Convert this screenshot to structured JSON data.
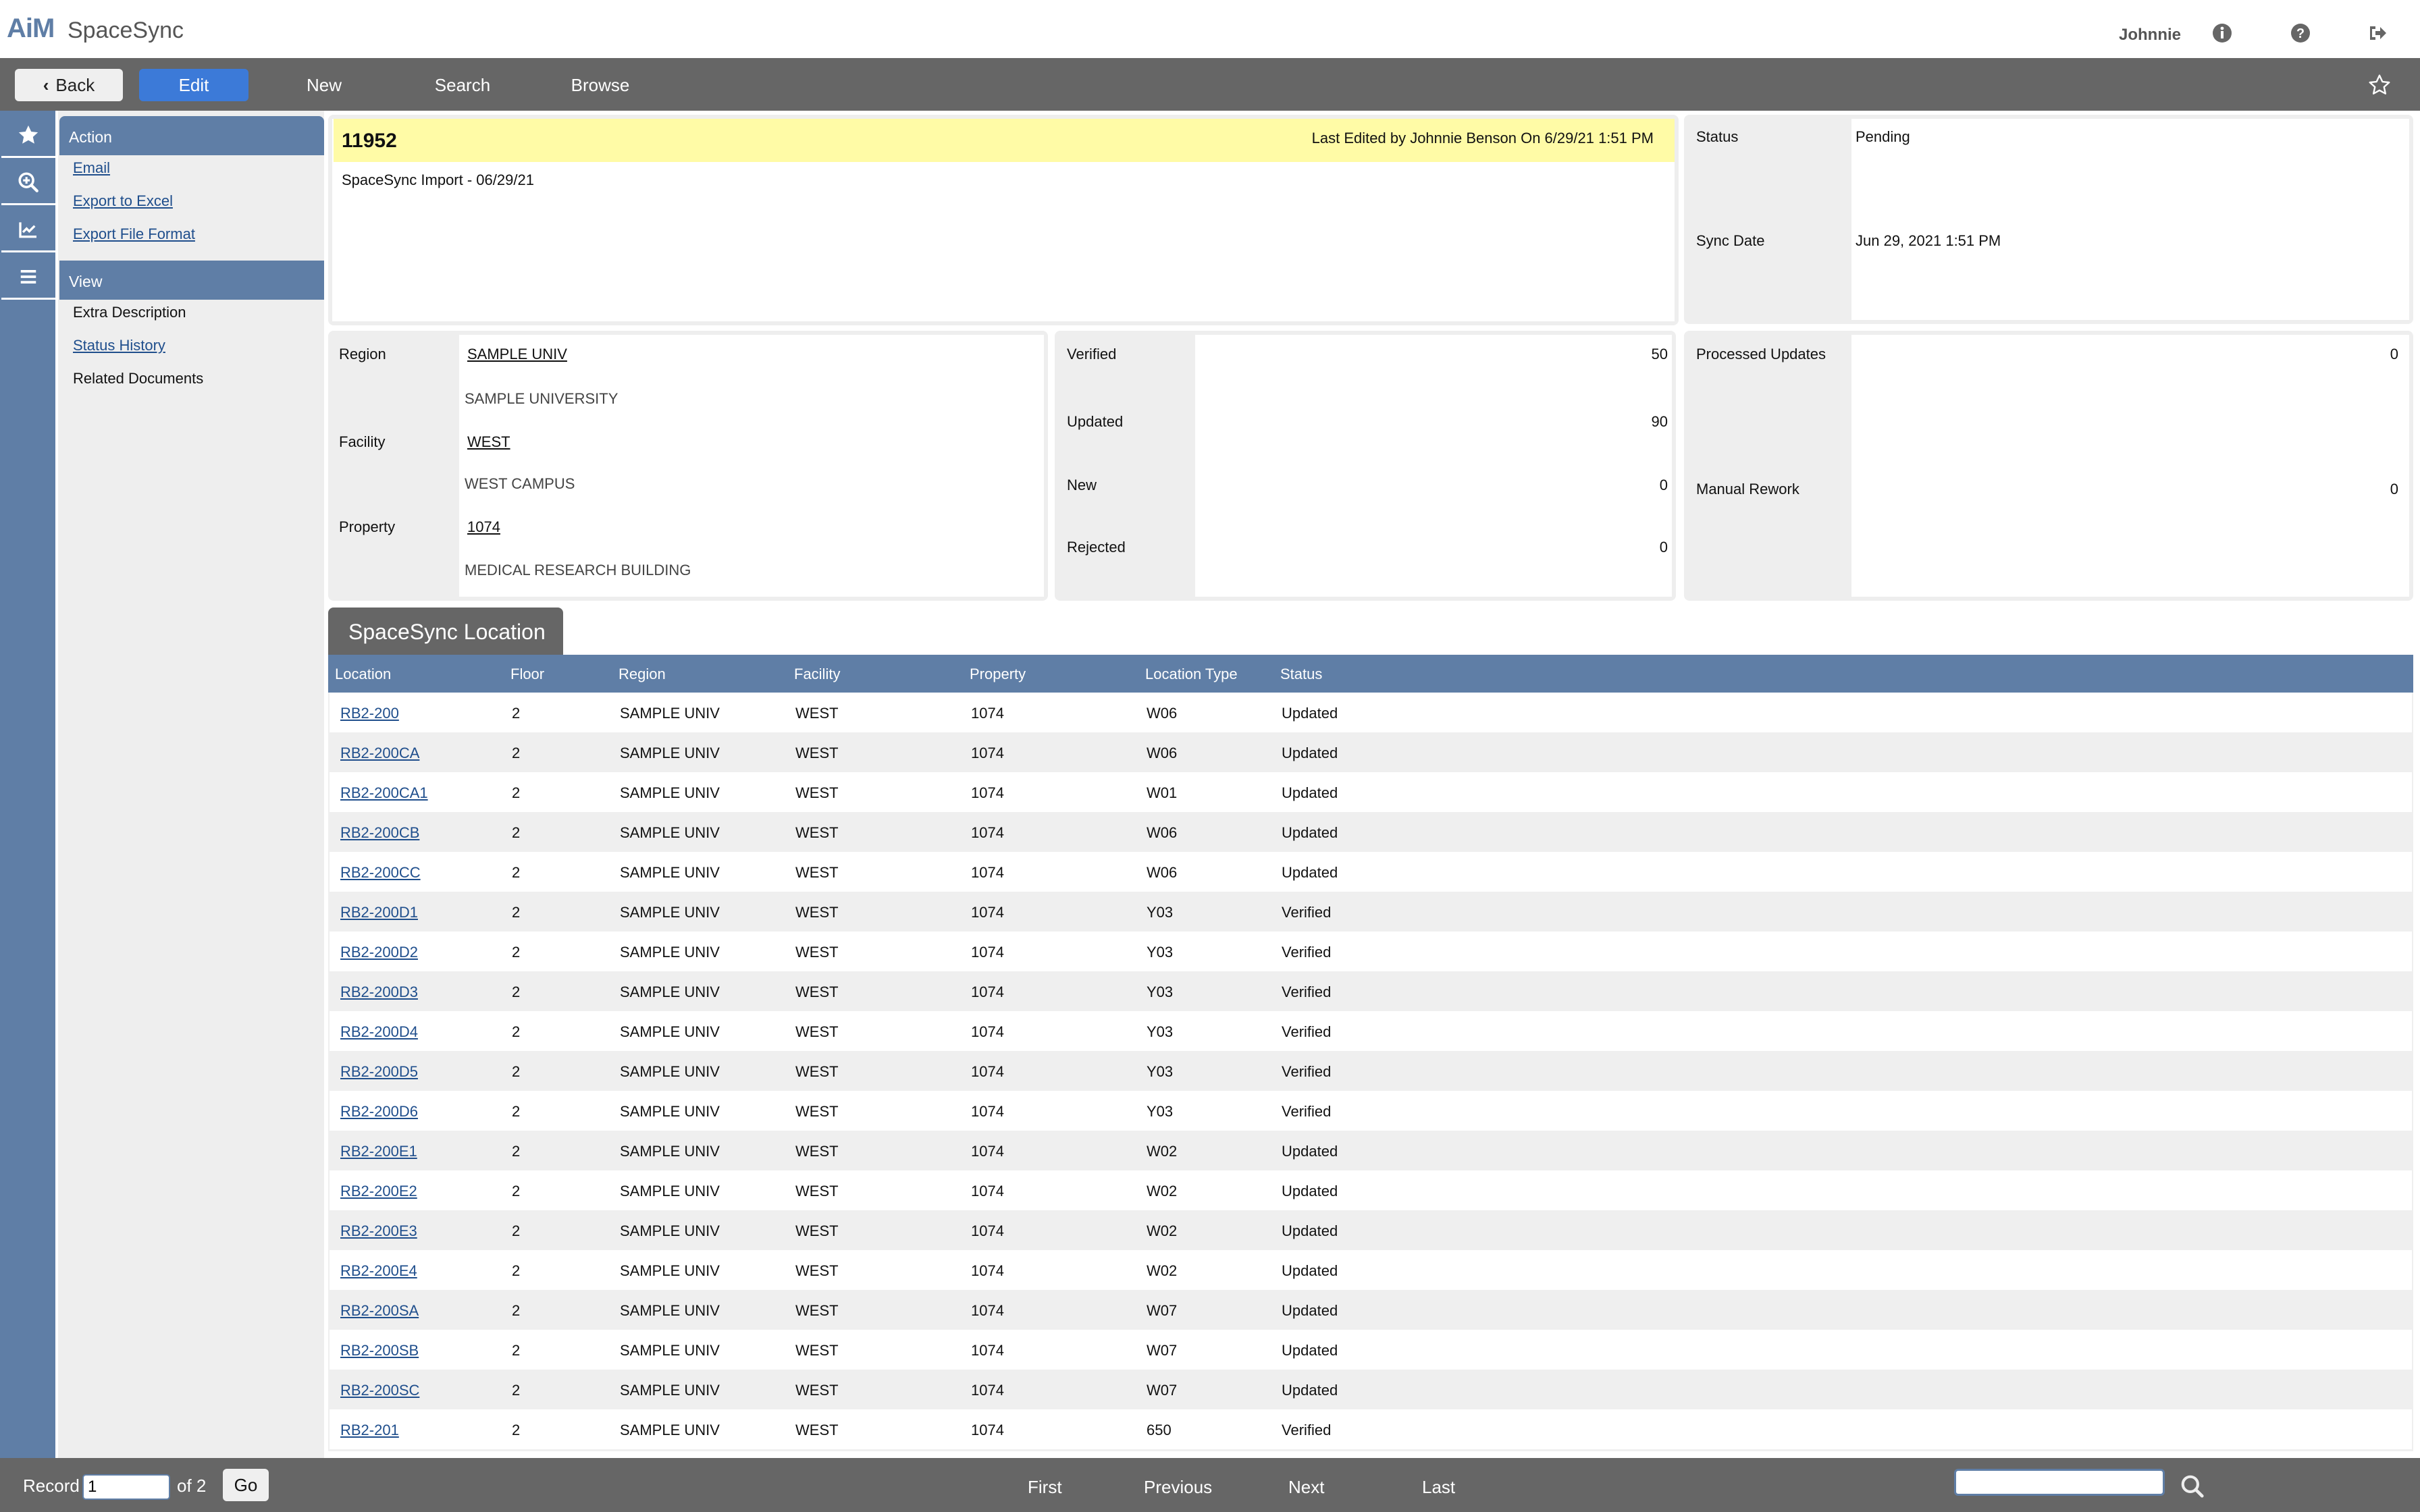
{
  "app": {
    "brand": "AiM",
    "title": "SpaceSync"
  },
  "header": {
    "user": "Johnnie",
    "icons": [
      "info-icon",
      "help-icon",
      "logout-icon"
    ]
  },
  "toolbar": {
    "back_label": "Back",
    "edit_label": "Edit",
    "new_label": "New",
    "search_label": "Search",
    "browse_label": "Browse",
    "favorite_icon": "star-outline-icon"
  },
  "rail": {
    "items": [
      "favorites-star-icon",
      "zoom-in-icon",
      "chart-line-icon",
      "menu-icon"
    ]
  },
  "sidebar": {
    "action_header": "Action",
    "actions": [
      "Email",
      "Export to Excel",
      "Export File Format"
    ],
    "view_header": "View",
    "views": [
      {
        "label": "Extra Description",
        "link": false
      },
      {
        "label": "Status History",
        "link": true
      },
      {
        "label": "Related Documents",
        "link": false
      }
    ]
  },
  "record": {
    "id": "11952",
    "last_edited": "Last Edited by Johnnie Benson On 6/29/21 1:51 PM",
    "description": "SpaceSync Import - 06/29/21"
  },
  "status_panel": {
    "status_label": "Status",
    "status_value": "Pending",
    "sync_date_label": "Sync Date",
    "sync_date_value": "Jun 29, 2021 1:51 PM"
  },
  "location_panel": {
    "region_label": "Region",
    "region_code": "SAMPLE UNIV",
    "region_desc": "SAMPLE UNIVERSITY",
    "facility_label": "Facility",
    "facility_code": "WEST",
    "facility_desc": "WEST CAMPUS",
    "property_label": "Property",
    "property_code": "1074",
    "property_desc": "MEDICAL RESEARCH BUILDING"
  },
  "counts_panel": {
    "verified_label": "Verified",
    "verified": "50",
    "updated_label": "Updated",
    "updated": "90",
    "new_label": "New",
    "new": "0",
    "rejected_label": "Rejected",
    "rejected": "0"
  },
  "process_panel": {
    "processed_label": "Processed Updates",
    "processed": "0",
    "rework_label": "Manual Rework",
    "rework": "0"
  },
  "location_tab": {
    "label": "SpaceSync Location"
  },
  "table": {
    "columns": [
      "Location",
      "Floor",
      "Region",
      "Facility",
      "Property",
      "Location Type",
      "Status"
    ],
    "rows": [
      [
        "RB2-200",
        "2",
        "SAMPLE UNIV",
        "WEST",
        "1074",
        "W06",
        "Updated"
      ],
      [
        "RB2-200CA",
        "2",
        "SAMPLE UNIV",
        "WEST",
        "1074",
        "W06",
        "Updated"
      ],
      [
        "RB2-200CA1",
        "2",
        "SAMPLE UNIV",
        "WEST",
        "1074",
        "W01",
        "Updated"
      ],
      [
        "RB2-200CB",
        "2",
        "SAMPLE UNIV",
        "WEST",
        "1074",
        "W06",
        "Updated"
      ],
      [
        "RB2-200CC",
        "2",
        "SAMPLE UNIV",
        "WEST",
        "1074",
        "W06",
        "Updated"
      ],
      [
        "RB2-200D1",
        "2",
        "SAMPLE UNIV",
        "WEST",
        "1074",
        "Y03",
        "Verified"
      ],
      [
        "RB2-200D2",
        "2",
        "SAMPLE UNIV",
        "WEST",
        "1074",
        "Y03",
        "Verified"
      ],
      [
        "RB2-200D3",
        "2",
        "SAMPLE UNIV",
        "WEST",
        "1074",
        "Y03",
        "Verified"
      ],
      [
        "RB2-200D4",
        "2",
        "SAMPLE UNIV",
        "WEST",
        "1074",
        "Y03",
        "Verified"
      ],
      [
        "RB2-200D5",
        "2",
        "SAMPLE UNIV",
        "WEST",
        "1074",
        "Y03",
        "Verified"
      ],
      [
        "RB2-200D6",
        "2",
        "SAMPLE UNIV",
        "WEST",
        "1074",
        "Y03",
        "Verified"
      ],
      [
        "RB2-200E1",
        "2",
        "SAMPLE UNIV",
        "WEST",
        "1074",
        "W02",
        "Updated"
      ],
      [
        "RB2-200E2",
        "2",
        "SAMPLE UNIV",
        "WEST",
        "1074",
        "W02",
        "Updated"
      ],
      [
        "RB2-200E3",
        "2",
        "SAMPLE UNIV",
        "WEST",
        "1074",
        "W02",
        "Updated"
      ],
      [
        "RB2-200E4",
        "2",
        "SAMPLE UNIV",
        "WEST",
        "1074",
        "W02",
        "Updated"
      ],
      [
        "RB2-200SA",
        "2",
        "SAMPLE UNIV",
        "WEST",
        "1074",
        "W07",
        "Updated"
      ],
      [
        "RB2-200SB",
        "2",
        "SAMPLE UNIV",
        "WEST",
        "1074",
        "W07",
        "Updated"
      ],
      [
        "RB2-200SC",
        "2",
        "SAMPLE UNIV",
        "WEST",
        "1074",
        "W07",
        "Updated"
      ],
      [
        "RB2-201",
        "2",
        "SAMPLE UNIV",
        "WEST",
        "1074",
        "650",
        "Verified"
      ]
    ]
  },
  "footer": {
    "record_label": "Record",
    "record_value": "1",
    "of_label": "of 2",
    "go_label": "Go",
    "first_label": "First",
    "previous_label": "Previous",
    "next_label": "Next",
    "last_label": "Last",
    "search_value": ""
  },
  "colors": {
    "brand_blue": "#5f7ea6",
    "edit_button": "#3c7ad8",
    "toolbar_gray": "#666666",
    "highlight_yellow": "#fffba6",
    "link": "#1f4e8c"
  }
}
